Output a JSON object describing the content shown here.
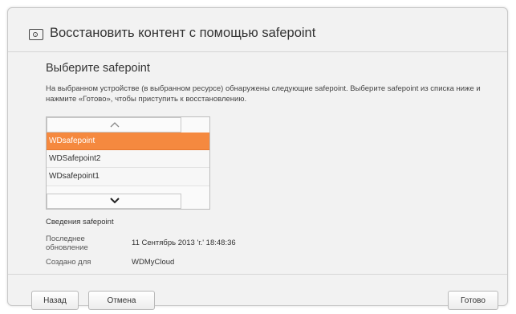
{
  "dialog": {
    "title": "Восстановить контент с помощью safepoint",
    "title_icon": "restore-box-icon"
  },
  "section": {
    "title": "Выберите safepoint",
    "description": "На выбранном устройстве (в выбранном ресурсе) обнаружены следующие safepoint. Выберите safepoint из списка ниже и нажмите «Готово», чтобы приступить к восстановлению."
  },
  "list": {
    "up_icon": "chevron-up-icon",
    "down_icon": "chevron-down-icon",
    "items": [
      {
        "label": "WDsafepoint",
        "selected": true
      },
      {
        "label": "WDSafepoint2",
        "selected": false
      },
      {
        "label": "WDsafepoint1",
        "selected": false
      }
    ]
  },
  "info": {
    "title": "Сведения safepoint",
    "last_update_label": "Последнее обновление",
    "last_update_value": "11 Сентябрь 2013 'г.' 18:48:36",
    "created_for_label": "Создано для",
    "created_for_value": "WDMyCloud"
  },
  "buttons": {
    "back": "Назад",
    "cancel": "Отмена",
    "done": "Готово"
  },
  "colors": {
    "selected_item": "#f5893f",
    "dialog_bg": "#f2f2f2"
  }
}
